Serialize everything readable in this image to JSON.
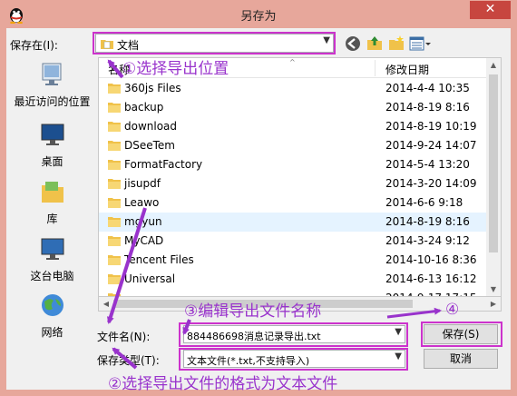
{
  "window": {
    "title": "另存为",
    "close_glyph": "✕"
  },
  "save_in": {
    "label": "保存在(I):",
    "value": "文档"
  },
  "places": [
    {
      "label": "最近访问的位置",
      "icon": "recent-places-icon"
    },
    {
      "label": "桌面",
      "icon": "desktop-icon"
    },
    {
      "label": "库",
      "icon": "libraries-icon"
    },
    {
      "label": "这台电脑",
      "icon": "computer-icon"
    },
    {
      "label": "网络",
      "icon": "network-icon"
    }
  ],
  "columns": {
    "name": "名称",
    "modified": "修改日期"
  },
  "files": [
    {
      "name": "360js Files",
      "date": "2014-4-4 10:35"
    },
    {
      "name": "backup",
      "date": "2014-8-19 8:16"
    },
    {
      "name": "download",
      "date": "2014-8-19 10:19"
    },
    {
      "name": "DSeeTem",
      "date": "2014-9-24 14:07"
    },
    {
      "name": "FormatFactory",
      "date": "2014-5-4 13:20"
    },
    {
      "name": "jisupdf",
      "date": "2014-3-20 14:09"
    },
    {
      "name": "Leawo",
      "date": "2014-6-6 9:18"
    },
    {
      "name": "mgyun",
      "date": "2014-8-19 8:16"
    },
    {
      "name": "MyCAD",
      "date": "2014-3-24 9:12"
    },
    {
      "name": "Tencent Files",
      "date": "2014-10-16 8:36"
    },
    {
      "name": "Universal",
      "date": "2014-6-13 16:12"
    },
    {
      "name": "",
      "date": "2014-9-17 17:15"
    }
  ],
  "filename": {
    "label": "文件名(N):",
    "value": "884486698消息记录导出.txt"
  },
  "filetype": {
    "label": "保存类型(T):",
    "value": "文本文件(*.txt,不支持导入)"
  },
  "buttons": {
    "save": "保存(S)",
    "cancel": "取消"
  },
  "annotations": {
    "step1": "①选择导出位置",
    "step2": "②选择导出文件的格式为文本文件",
    "step3": "③编辑导出文件名称",
    "step4": "④"
  },
  "colors": {
    "annotation": "#9933cc",
    "highlight": "#cc33cc",
    "frame": "#e7a79b",
    "close": "#c7463f",
    "selection": "#e5f3ff",
    "folder": "#f0c24a"
  }
}
